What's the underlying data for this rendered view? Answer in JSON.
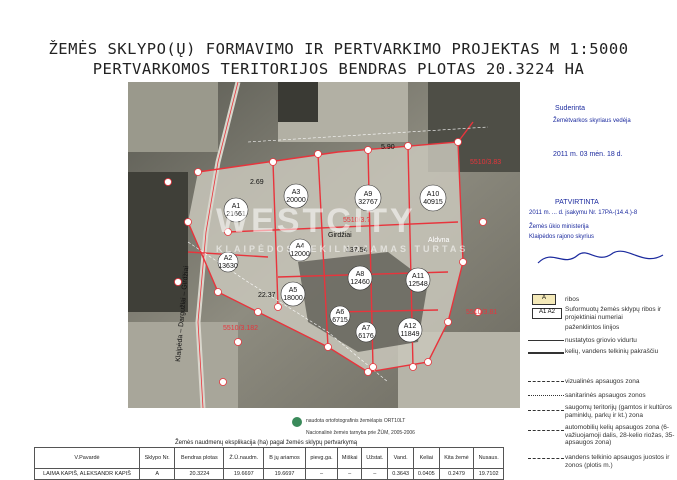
{
  "title_line1": "ŽEMĖS  SKLYPO(Ų) FORMAVIMO IR PERTVARKIMO PROJEKTAS M 1:5000",
  "title_line2": "PERTVARKOMOS TERITORIJOS BENDRAS PLOTAS 20.3224 HA",
  "watermark": {
    "main": "WESTCITY",
    "sub": "KLAIPĖDOS NEKILNOJAMAS TURTAS"
  },
  "parcels": [
    {
      "id": "A1",
      "area": "21661"
    },
    {
      "id": "A2",
      "area": "13630"
    },
    {
      "id": "A3",
      "area": "20000"
    },
    {
      "id": "A4",
      "area": "12000"
    },
    {
      "id": "A5",
      "area": "18000"
    },
    {
      "id": "A6",
      "area": "6715"
    },
    {
      "id": "A7",
      "area": "6176"
    },
    {
      "id": "A8",
      "area": "12460"
    },
    {
      "id": "A9",
      "area": "32767"
    },
    {
      "id": "A10",
      "area": "40915"
    },
    {
      "id": "A11",
      "area": "12548"
    },
    {
      "id": "A12",
      "area": "11849"
    }
  ],
  "map_labels": {
    "road1": "5510/3.83",
    "road2": "5510/3.182",
    "road3": "5510/3.81",
    "cadastral": "5510/3.?",
    "road_name": "Klaipėda – Dargužiai – Girdžiai",
    "place1": "Aldvna",
    "place2": "Girdžiai",
    "dim1": "137.54",
    "dim2": "5.90",
    "dim3": "2.69",
    "dim4": "22.37"
  },
  "stamp": {
    "line1": "Suderinta",
    "line2": "Žemėtvarkos skyriaus vedėja",
    "line3": "2011 m. 03 mėn. 18 d.",
    "line4": "PATVIRTINTA",
    "line5": "2011 m. ... d. įsakymu Nr. 17PA-(14.4.)-8",
    "line6": "Žemės ūkio ministerija",
    "line7": "Klaipėdos rajono skyrius"
  },
  "legend": {
    "A_label": "A",
    "A_text": "ribos",
    "A1A2_label": "A1  A2",
    "A1A2_text": "Suformuotų žemės sklypų ribos ir projektiniai numeriai",
    "item3": "paženklintos linijos",
    "item4": "nustatytos griovio vidurtu",
    "item5": "kelių, vandens telkinių pakraščiu",
    "item6": "vizualinės apsaugos zona",
    "item7": "sanitarinės apsaugos zonos",
    "item8": "saugomų teritorijų (gamtos ir kultūros paminklų, parkų ir kt.) zona",
    "item9": "automobilių kelių apsaugos zona (6-važiuojamoji dalis, 28-kelio riožas, 35-apsaugos zona)",
    "item10": "vandens telkinio apsaugos juostos ir zonos (plotis m.)"
  },
  "source_note1": "naudota ortofotografinis žemėlapis ORT10LT",
  "source_note2": "Nacionalinė žemės tarnyba prie ŽŪM, 2005-2006",
  "table": {
    "caption": "Žemės naudmenų eksplikacija (ha) pagal žemės sklypų pertvarkymą",
    "headers": [
      "V.Pavardė",
      "Sklypo Nr.",
      "Bendras plotas",
      "Ž.Ū.naudm.",
      "B jų ariamos",
      "pievg.ga.",
      "Miškai",
      "Užstat.",
      "Vand.",
      "Keliai",
      "Kita žemė",
      "Nusaus."
    ],
    "row": [
      "LAIMA KAPIŠ, ALEKSANDR KAPIŠ",
      "A",
      "20.3224",
      "19.6697",
      "19.6697",
      "–",
      "–",
      "–",
      "0.3643",
      "0.0405",
      "0.2479",
      "19.7102"
    ]
  },
  "colors": {
    "boundary": "#e8343c",
    "stamp": "#1b2a9e",
    "marker": "#e8343c"
  }
}
